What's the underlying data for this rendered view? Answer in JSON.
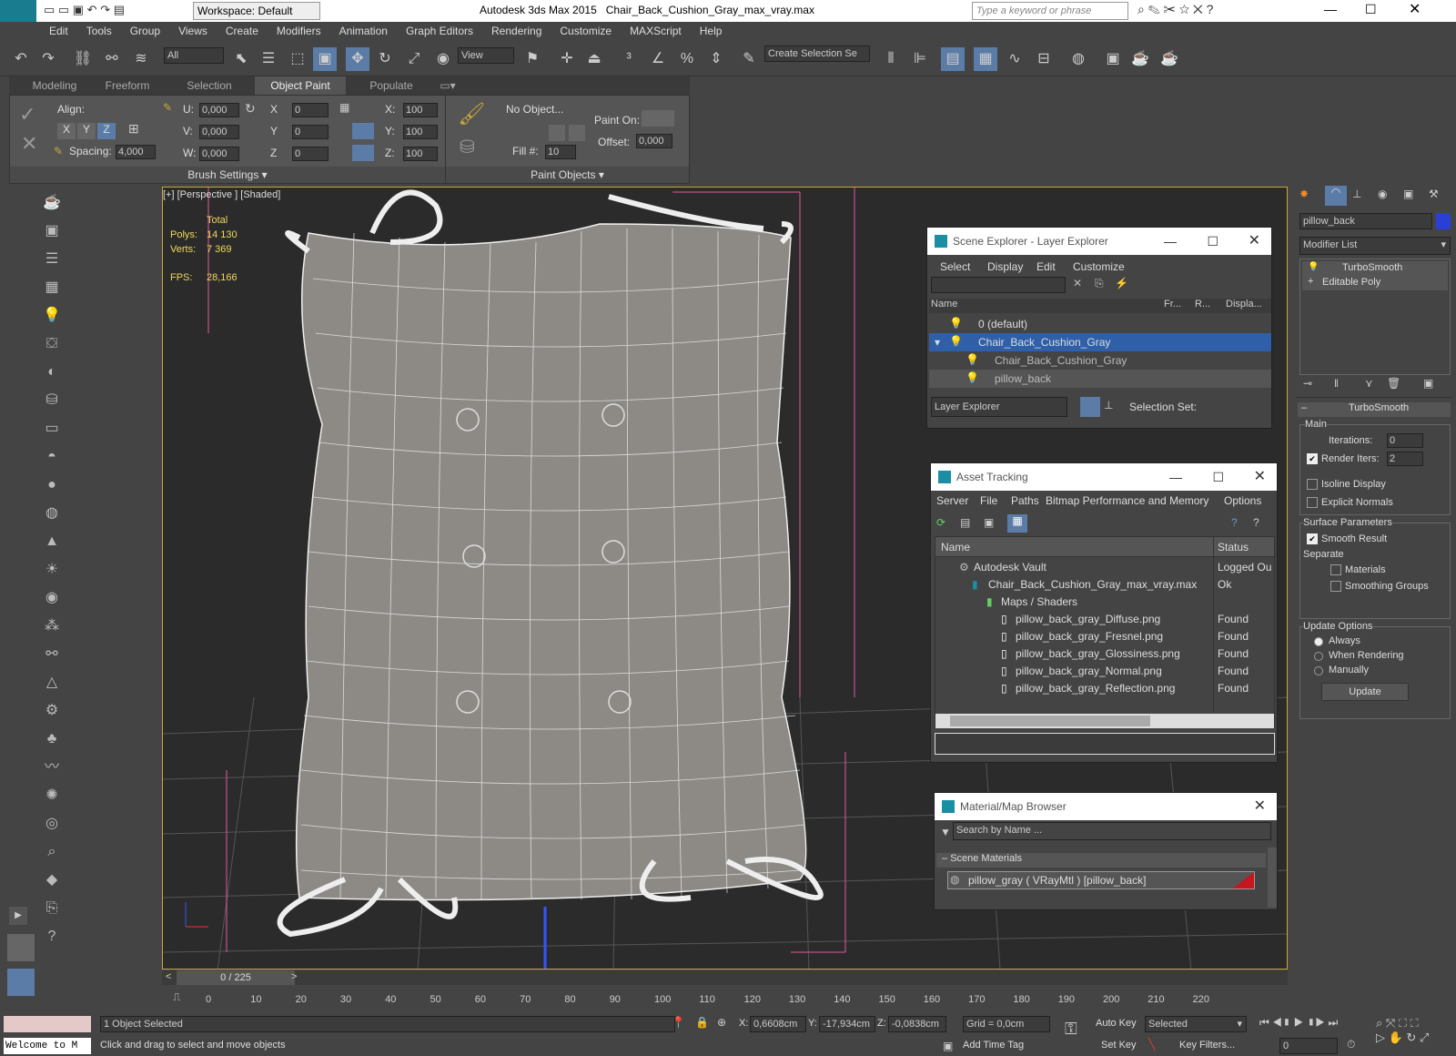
{
  "title": {
    "app": "Autodesk 3ds Max  2015",
    "file": "Chair_Back_Cushion_Gray_max_vray.max",
    "workspace": "Workspace: Default",
    "search_placeholder": "Type a keyword or phrase"
  },
  "menu": [
    "Edit",
    "Tools",
    "Group",
    "Views",
    "Create",
    "Modifiers",
    "Animation",
    "Graph Editors",
    "Rendering",
    "Customize",
    "MAXScript",
    "Help"
  ],
  "toolbar": {
    "filter": "All",
    "view": "View",
    "selection_set": "Create Selection Se"
  },
  "ribbon": {
    "tabs": [
      "Modeling",
      "Freeform",
      "Selection",
      "Object Paint",
      "Populate"
    ],
    "align": "Align:",
    "x": "X",
    "y": "Y",
    "z": "Z",
    "spacing_label": "Spacing:",
    "spacing": "4,000",
    "u": "U:",
    "v": "V:",
    "w": "W:",
    "u_val": "0,000",
    "v_val": "0,000",
    "w_val": "0,000",
    "rx": "X",
    "ry": "Y",
    "rz": "Z",
    "rx_val": "0",
    "ry_val": "0",
    "rz_val": "0",
    "sx": "X:",
    "sy": "Y:",
    "sz": "Z:",
    "sx_val": "100",
    "sy_val": "100",
    "sz_val": "100",
    "no_object": "No Object...",
    "fill_label": "Fill #:",
    "fill": "10",
    "paint_on": "Paint On:",
    "offset_label": "Offset:",
    "offset": "0,000",
    "brush_settings": "Brush Settings",
    "paint_objects": "Paint Objects"
  },
  "viewport": {
    "label": "[+] [Perspective ] [Shaded]",
    "total": "Total",
    "polys_label": "Polys:",
    "polys": "14 130",
    "verts_label": "Verts:",
    "verts": "7 369",
    "fps_label": "FPS:",
    "fps": "28,166"
  },
  "scene_explorer": {
    "title": "Scene Explorer - Layer Explorer",
    "menu": [
      "Select",
      "Display",
      "Edit",
      "Customize"
    ],
    "cols": [
      "Name",
      "Fr...",
      "R...",
      "Displa..."
    ],
    "rows": [
      "0 (default)",
      "Chair_Back_Cushion_Gray",
      "Chair_Back_Cushion_Gray",
      "pillow_back"
    ],
    "footer": "Layer Explorer",
    "selection_set": "Selection Set:"
  },
  "asset": {
    "title": "Asset Tracking",
    "menu": [
      "Server",
      "File",
      "Paths",
      "Bitmap Performance and Memory",
      "Options"
    ],
    "cols": [
      "Name",
      "Status"
    ],
    "rows": [
      {
        "name": "Autodesk Vault",
        "status": "Logged Ou"
      },
      {
        "name": "Chair_Back_Cushion_Gray_max_vray.max",
        "status": "Ok"
      },
      {
        "name": "Maps / Shaders",
        "status": ""
      },
      {
        "name": "pillow_back_gray_Diffuse.png",
        "status": "Found"
      },
      {
        "name": "pillow_back_gray_Fresnel.png",
        "status": "Found"
      },
      {
        "name": "pillow_back_gray_Glossiness.png",
        "status": "Found"
      },
      {
        "name": "pillow_back_gray_Normal.png",
        "status": "Found"
      },
      {
        "name": "pillow_back_gray_Reflection.png",
        "status": "Found"
      }
    ]
  },
  "material": {
    "title": "Material/Map Browser",
    "search": "Search by Name ...",
    "section": "Scene Materials",
    "item": "pillow_gray  ( VRayMtl )  [pillow_back]"
  },
  "cmd": {
    "object_name": "pillow_back",
    "modifier_list": "Modifier List",
    "stack": [
      "TurboSmooth",
      "Editable Poly"
    ],
    "rollout": "TurboSmooth",
    "main": "Main",
    "iterations_label": "Iterations:",
    "iterations": "0",
    "render_iters_label": "Render Iters:",
    "render_iters": "2",
    "isoline": "Isoline Display",
    "explicit": "Explicit Normals",
    "surface": "Surface Parameters",
    "smooth_result": "Smooth Result",
    "separate": "Separate",
    "materials": "Materials",
    "smoothing_groups": "Smoothing Groups",
    "update_options": "Update Options",
    "always": "Always",
    "when_rendering": "When Rendering",
    "manually": "Manually",
    "update": "Update"
  },
  "timeline": {
    "frame": "0 / 225",
    "ticks": [
      "0",
      "10",
      "20",
      "30",
      "40",
      "50",
      "60",
      "70",
      "80",
      "90",
      "100",
      "110",
      "120",
      "130",
      "140",
      "150",
      "160",
      "170",
      "180",
      "190",
      "200",
      "210",
      "220"
    ]
  },
  "status": {
    "welcome": "Welcome to M",
    "selected": "1 Object Selected",
    "hint": "Click and drag to select and move objects",
    "x_label": "X:",
    "x": "0,6608cm",
    "y_label": "Y:",
    "y": "-17,934cm",
    "z_label": "Z:",
    "z": "-0,0838cm",
    "grid": "Grid = 0,0cm",
    "add_time_tag": "Add Time Tag",
    "auto_key": "Auto Key",
    "set_key": "Set Key",
    "selected_mode": "Selected",
    "key_filters": "Key Filters...",
    "frame": "0"
  }
}
